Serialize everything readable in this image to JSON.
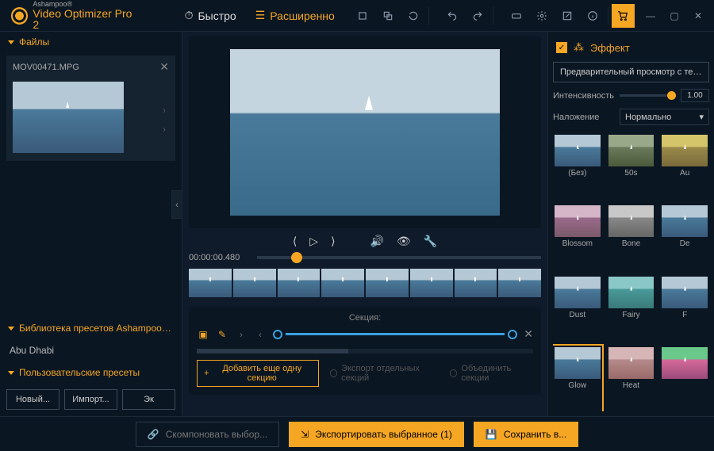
{
  "brand": "Ashampoo®",
  "product": "Video Optimizer Pro 2",
  "modes": {
    "fast": "Быстро",
    "advanced": "Расширенно"
  },
  "sidebar": {
    "files_header": "Файлы",
    "file_name": "MOV00471.MPG",
    "preset_lib_header": "Библиотека пресетов Ashampoo Video",
    "preset_lib_item": "Abu Dhabi",
    "user_presets_header": "Пользовательские пресеты",
    "btn_new": "Новый...",
    "btn_import": "Импорт...",
    "btn_export": "Эк"
  },
  "playback": {
    "timecode": "00:00:00.480"
  },
  "section": {
    "label": "Секция:",
    "add_btn": "Добавить еще одну секцию",
    "export_separate": "Экспорт отдельных секций",
    "merge": "Объединить секции"
  },
  "effects": {
    "header": "Эффект",
    "preview_btn": "Предварительный просмотр с текущим к...",
    "intensity_label": "Интенсивность",
    "intensity_value": "1.00",
    "overlay_label": "Наложение",
    "overlay_value": "Нормально",
    "list": [
      "(Без)",
      "50s",
      "Au",
      "Blossom",
      "Bone",
      "De",
      "Dust",
      "Fairy",
      "F",
      "Glow",
      "Heat",
      ""
    ],
    "selected": "Glow"
  },
  "bottom": {
    "compose": "Скомпоновать выбор...",
    "export": "Экспортировать выбранное (1)",
    "save": "Сохранить в..."
  }
}
